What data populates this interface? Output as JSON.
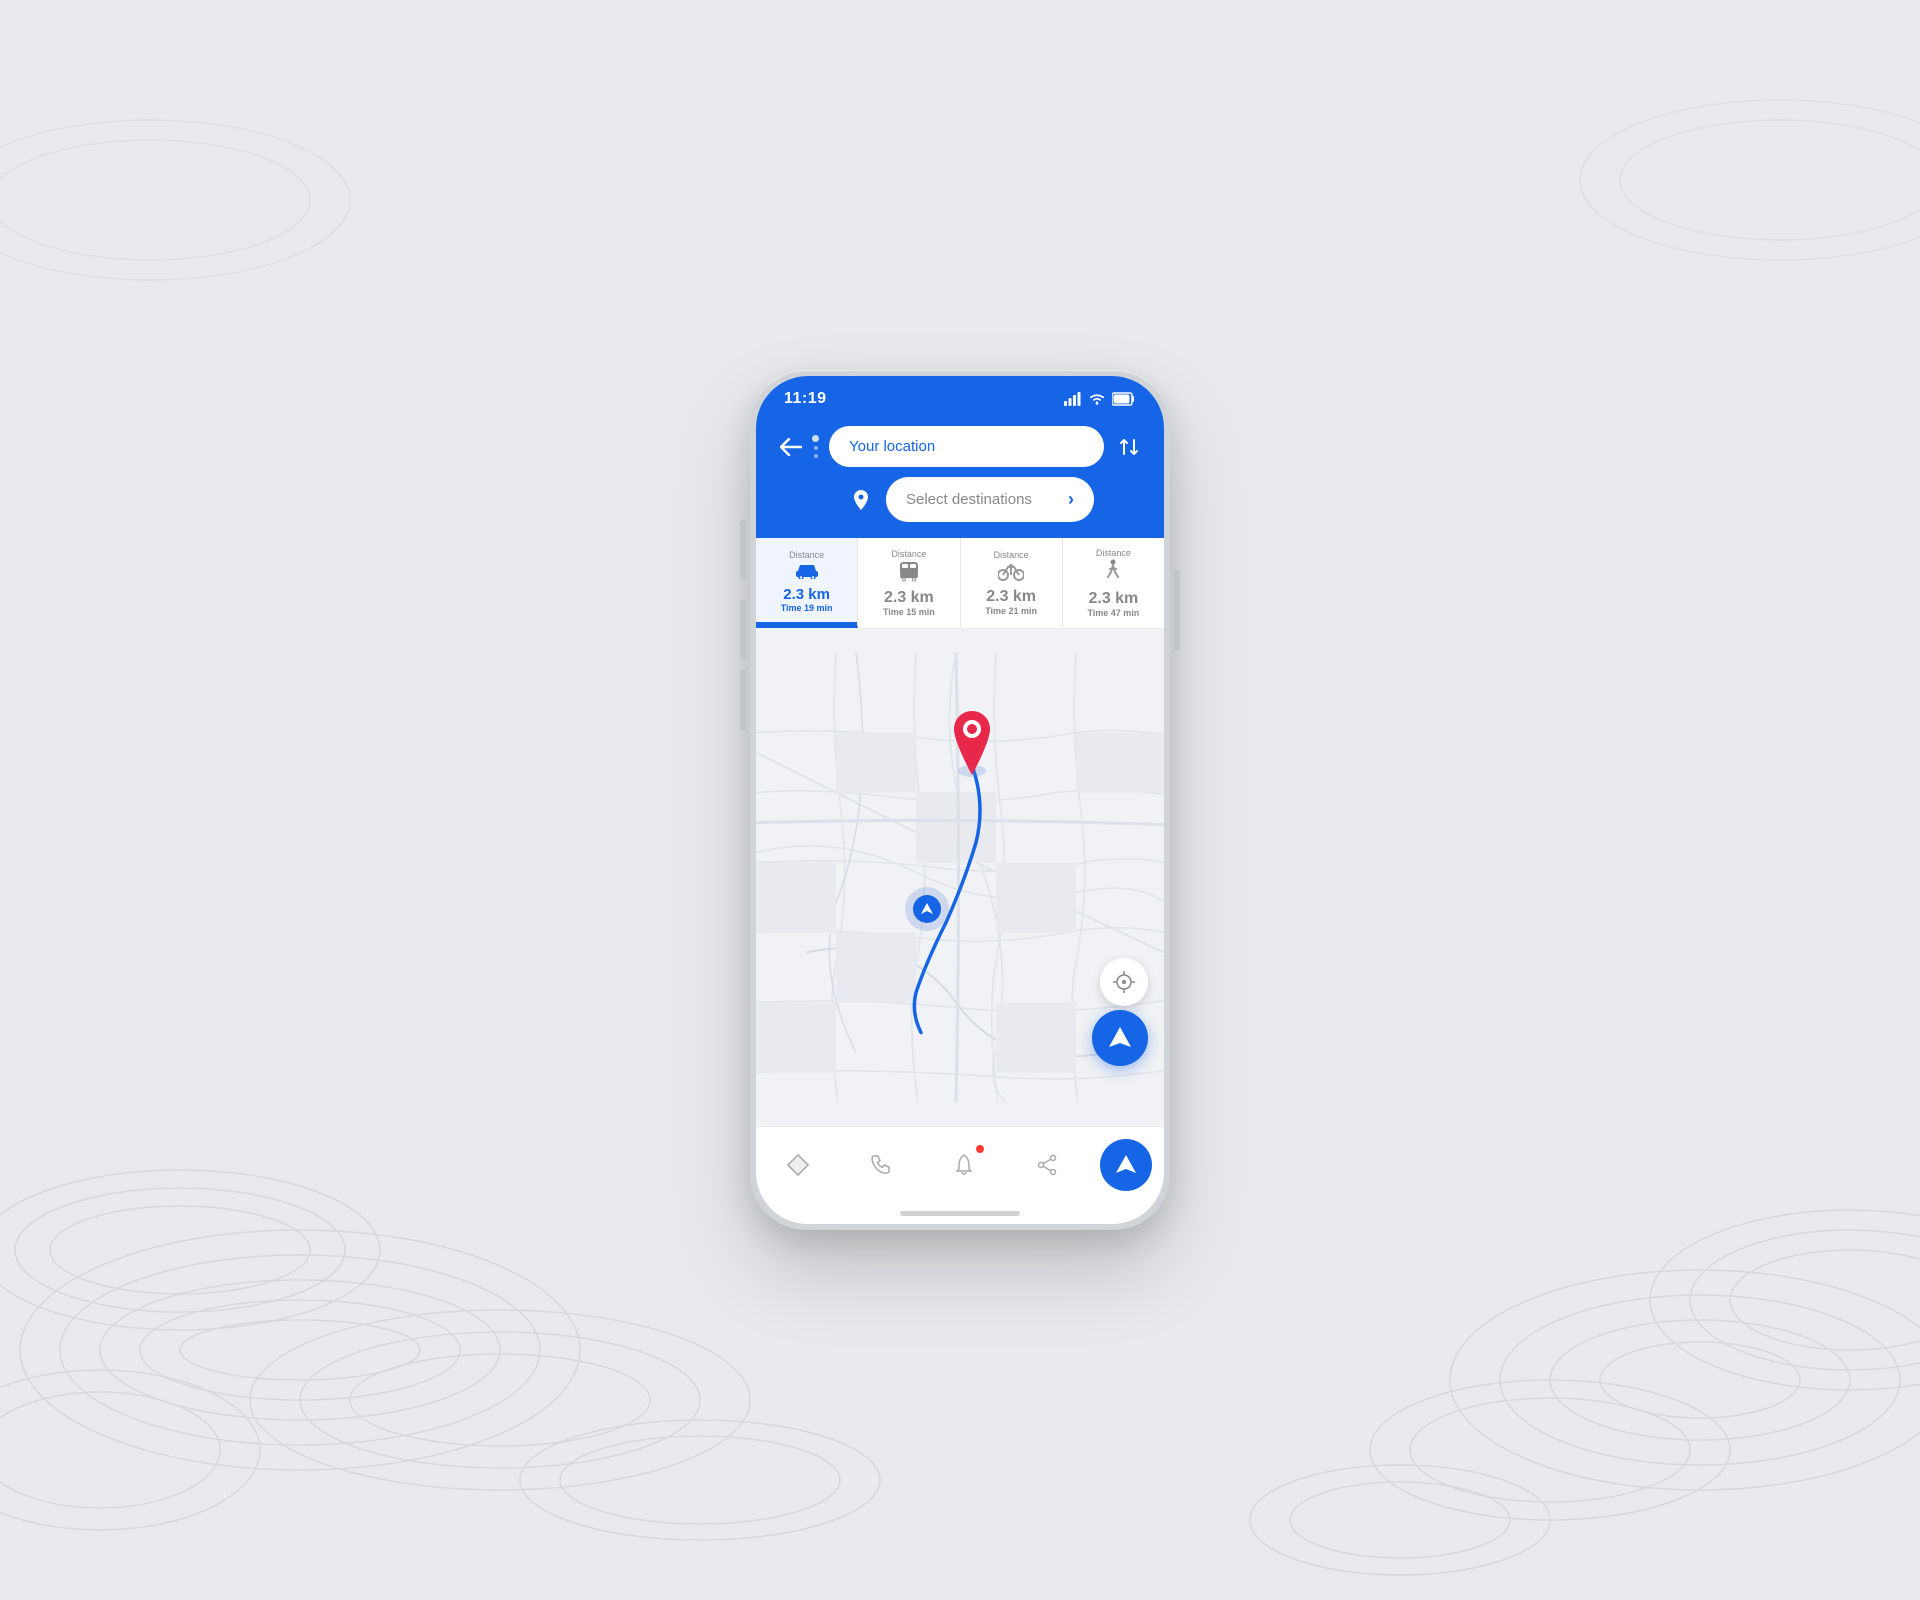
{
  "page": {
    "background_color": "#e8eaed"
  },
  "status_bar": {
    "time": "11:19",
    "signal_bars": 4,
    "wifi": true,
    "battery": 85
  },
  "header": {
    "location_placeholder": "Your location",
    "destination_placeholder": "Select destinations"
  },
  "transport_tabs": [
    {
      "id": "car",
      "label": "Distance",
      "distance": "2.3 km",
      "time_label": "Time",
      "time_value": "19 min",
      "active": true,
      "icon": "car"
    },
    {
      "id": "bus",
      "label": "Distance",
      "distance": "2.3 km",
      "time_label": "Time",
      "time_value": "15 min",
      "active": false,
      "icon": "bus"
    },
    {
      "id": "bike",
      "label": "Distance",
      "distance": "2.3 km",
      "time_label": "Time",
      "time_value": "21 min",
      "active": false,
      "icon": "bike"
    },
    {
      "id": "walk",
      "label": "Distance",
      "distance": "2.3 km",
      "time_label": "Time",
      "time_value": "47 min",
      "active": false,
      "icon": "walk"
    }
  ],
  "bottom_nav": {
    "items": [
      {
        "id": "map",
        "icon": "diamond",
        "label": "",
        "active": false
      },
      {
        "id": "phone",
        "icon": "phone",
        "label": "",
        "active": false
      },
      {
        "id": "notification",
        "icon": "bell",
        "label": "",
        "active": false,
        "has_dot": true
      },
      {
        "id": "share",
        "icon": "share",
        "label": "",
        "active": false
      },
      {
        "id": "navigate",
        "icon": "navigate",
        "label": "",
        "active": true
      }
    ]
  },
  "colors": {
    "primary": "#1565e6",
    "accent_red": "#e8284a",
    "tab_active_bg": "#eef2ff",
    "map_bg": "#f0f2f5"
  }
}
